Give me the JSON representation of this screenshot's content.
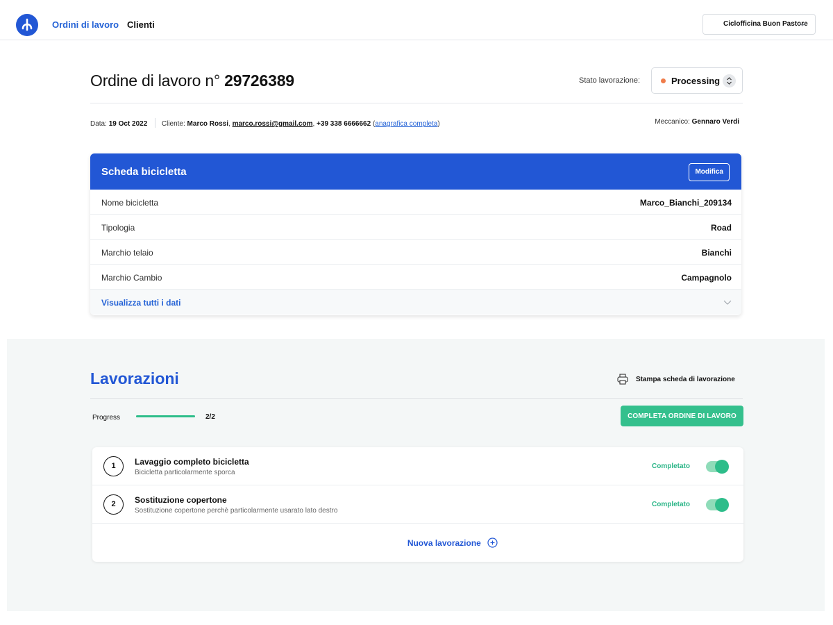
{
  "nav": {
    "items": [
      {
        "label": "Ordini di lavoro",
        "active": true
      },
      {
        "label": "Clienti",
        "active": false
      }
    ],
    "shop_selector": {
      "value": "Ciclofficina Buon Pastore"
    }
  },
  "order": {
    "title_prefix": "Ordine di lavoro n°",
    "number": "29726389",
    "state": {
      "label": "Stato lavorazione:",
      "value": "Processing",
      "color": "#f07c4a"
    },
    "meta": {
      "date_label": "Data:",
      "date": "19 Oct 2022",
      "client_label": "Cliente:",
      "client_name": "Marco Rossi",
      "client_email": "marco.rossi@gmail.com",
      "client_phone": "+39 338 6666662",
      "client_link": "anagrafica completa",
      "mechanic_label": "Meccanico:",
      "mechanic": "Gennaro Verdi"
    }
  },
  "bike_card": {
    "title": "Scheda bicicletta",
    "edit_label": "Modifica",
    "rows": [
      {
        "label": "Nome bicicletta",
        "value": "Marco_Bianchi_209134"
      },
      {
        "label": "Tipologia",
        "value": "Road"
      },
      {
        "label": "Marchio telaio",
        "value": "Bianchi"
      },
      {
        "label": "Marchio Cambio",
        "value": "Campagnolo"
      }
    ],
    "show_all_label": "Visualizza tutti i dati",
    "header_color": "#2257d5"
  },
  "work": {
    "title": "Lavorazioni",
    "print_label": "Stampa scheda di lavorazione",
    "progress": {
      "label": "Progress",
      "count": "2/2",
      "fraction": 1.0
    },
    "complete_label": "COMPLETA ORDINE DI LAVORO",
    "tasks": [
      {
        "number": "1",
        "title": "Lavaggio completo bicicletta",
        "description": "Bicicletta particolarmente sporca",
        "status": "Completato",
        "enabled": true
      },
      {
        "number": "2",
        "title": "Sostituzione copertone",
        "description": "Sostituzione copertone perchè particolarmente usarato lato destro",
        "status": "Completato",
        "enabled": true
      }
    ],
    "new_task_label": "Nuova lavorazione",
    "accent_color": "#2dbd8a"
  },
  "icons": {
    "logo": "app-logo-icon",
    "print": "printer-icon",
    "plus": "plus-circle-icon",
    "chevron": "chevron-down-icon",
    "stepper": "up-down-stepper-icon"
  }
}
